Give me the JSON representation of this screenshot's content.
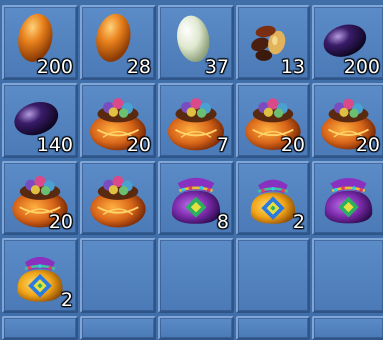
{
  "inventory": {
    "slots": [
      {
        "icon": "orange-egg-icon",
        "quantity": "200"
      },
      {
        "icon": "orange-egg-icon",
        "quantity": "28"
      },
      {
        "icon": "pale-green-egg-icon",
        "quantity": "37"
      },
      {
        "icon": "seeds-icon",
        "quantity": "13"
      },
      {
        "icon": "purple-egg-icon",
        "quantity": "200"
      },
      {
        "icon": "purple-egg-icon",
        "quantity": "140"
      },
      {
        "icon": "orange-gem-pouch-icon",
        "quantity": "20"
      },
      {
        "icon": "orange-gem-pouch-icon",
        "quantity": "7"
      },
      {
        "icon": "orange-gem-pouch-icon",
        "quantity": "20"
      },
      {
        "icon": "orange-gem-pouch-icon",
        "quantity": "20"
      },
      {
        "icon": "orange-gem-pouch-icon",
        "quantity": "20"
      },
      {
        "icon": "orange-gem-pouch-icon",
        "quantity": ""
      },
      {
        "icon": "purple-pouch-icon",
        "quantity": "8"
      },
      {
        "icon": "golden-pouch-icon",
        "quantity": "2"
      },
      {
        "icon": "purple-pouch-icon",
        "quantity": ""
      },
      {
        "icon": "golden-pouch-icon",
        "quantity": "2"
      },
      {
        "icon": "",
        "quantity": ""
      },
      {
        "icon": "",
        "quantity": ""
      },
      {
        "icon": "",
        "quantity": ""
      },
      {
        "icon": "",
        "quantity": ""
      },
      {
        "icon": "",
        "quantity": ""
      },
      {
        "icon": "",
        "quantity": ""
      },
      {
        "icon": "",
        "quantity": ""
      },
      {
        "icon": "",
        "quantity": ""
      },
      {
        "icon": "",
        "quantity": ""
      }
    ]
  },
  "colors": {
    "orange_egg": "#e8801c",
    "pale_egg": "#dfe8cf",
    "purple_egg": "#3a1c6a",
    "orange_pouch": "#d9661a",
    "purple_pouch": "#7a2aa8",
    "golden_pouch": "#f0a418",
    "slot_bg": "#4f7eba"
  }
}
